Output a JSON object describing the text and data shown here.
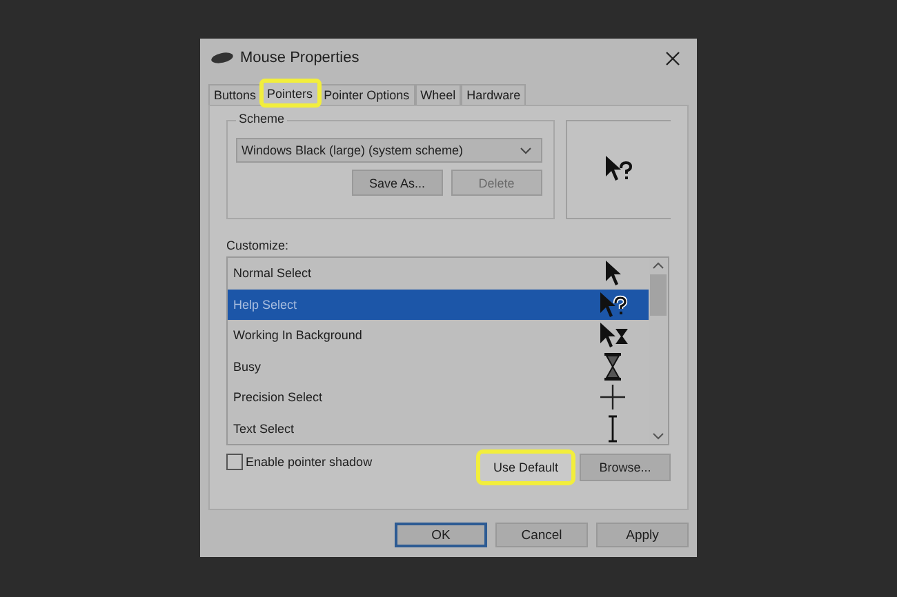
{
  "window": {
    "title": "Mouse Properties"
  },
  "tabs": [
    {
      "label": "Buttons",
      "selected": false,
      "highlighted": false
    },
    {
      "label": "Pointers",
      "selected": true,
      "highlighted": true
    },
    {
      "label": "Pointer Options",
      "selected": false,
      "highlighted": false
    },
    {
      "label": "Wheel",
      "selected": false,
      "highlighted": false
    },
    {
      "label": "Hardware",
      "selected": false,
      "highlighted": false
    }
  ],
  "scheme": {
    "label": "Scheme",
    "value": "Windows Black (large) (system scheme)",
    "buttons": [
      {
        "label": "Save As...",
        "disabled": false
      },
      {
        "label": "Delete",
        "disabled": true
      }
    ]
  },
  "preview": {
    "kind": "help"
  },
  "customize": {
    "label": "Customize:",
    "items": [
      {
        "label": "Normal Select",
        "kind": "arrow",
        "selected": false
      },
      {
        "label": "Help Select",
        "kind": "help",
        "selected": true
      },
      {
        "label": "Working In Background",
        "kind": "working",
        "selected": false
      },
      {
        "label": "Busy",
        "kind": "busy",
        "selected": false
      },
      {
        "label": "Precision Select",
        "kind": "precision",
        "selected": false
      },
      {
        "label": "Text Select",
        "kind": "text",
        "selected": false
      }
    ]
  },
  "shadow": {
    "label": "Enable pointer shadow",
    "checked": false
  },
  "list_buttons": [
    {
      "label": "Use Default",
      "highlighted": true
    },
    {
      "label": "Browse...",
      "highlighted": false
    }
  ],
  "footer_buttons": [
    {
      "label": "OK",
      "default": true
    },
    {
      "label": "Cancel",
      "default": false
    },
    {
      "label": "Apply",
      "default": false
    }
  ]
}
